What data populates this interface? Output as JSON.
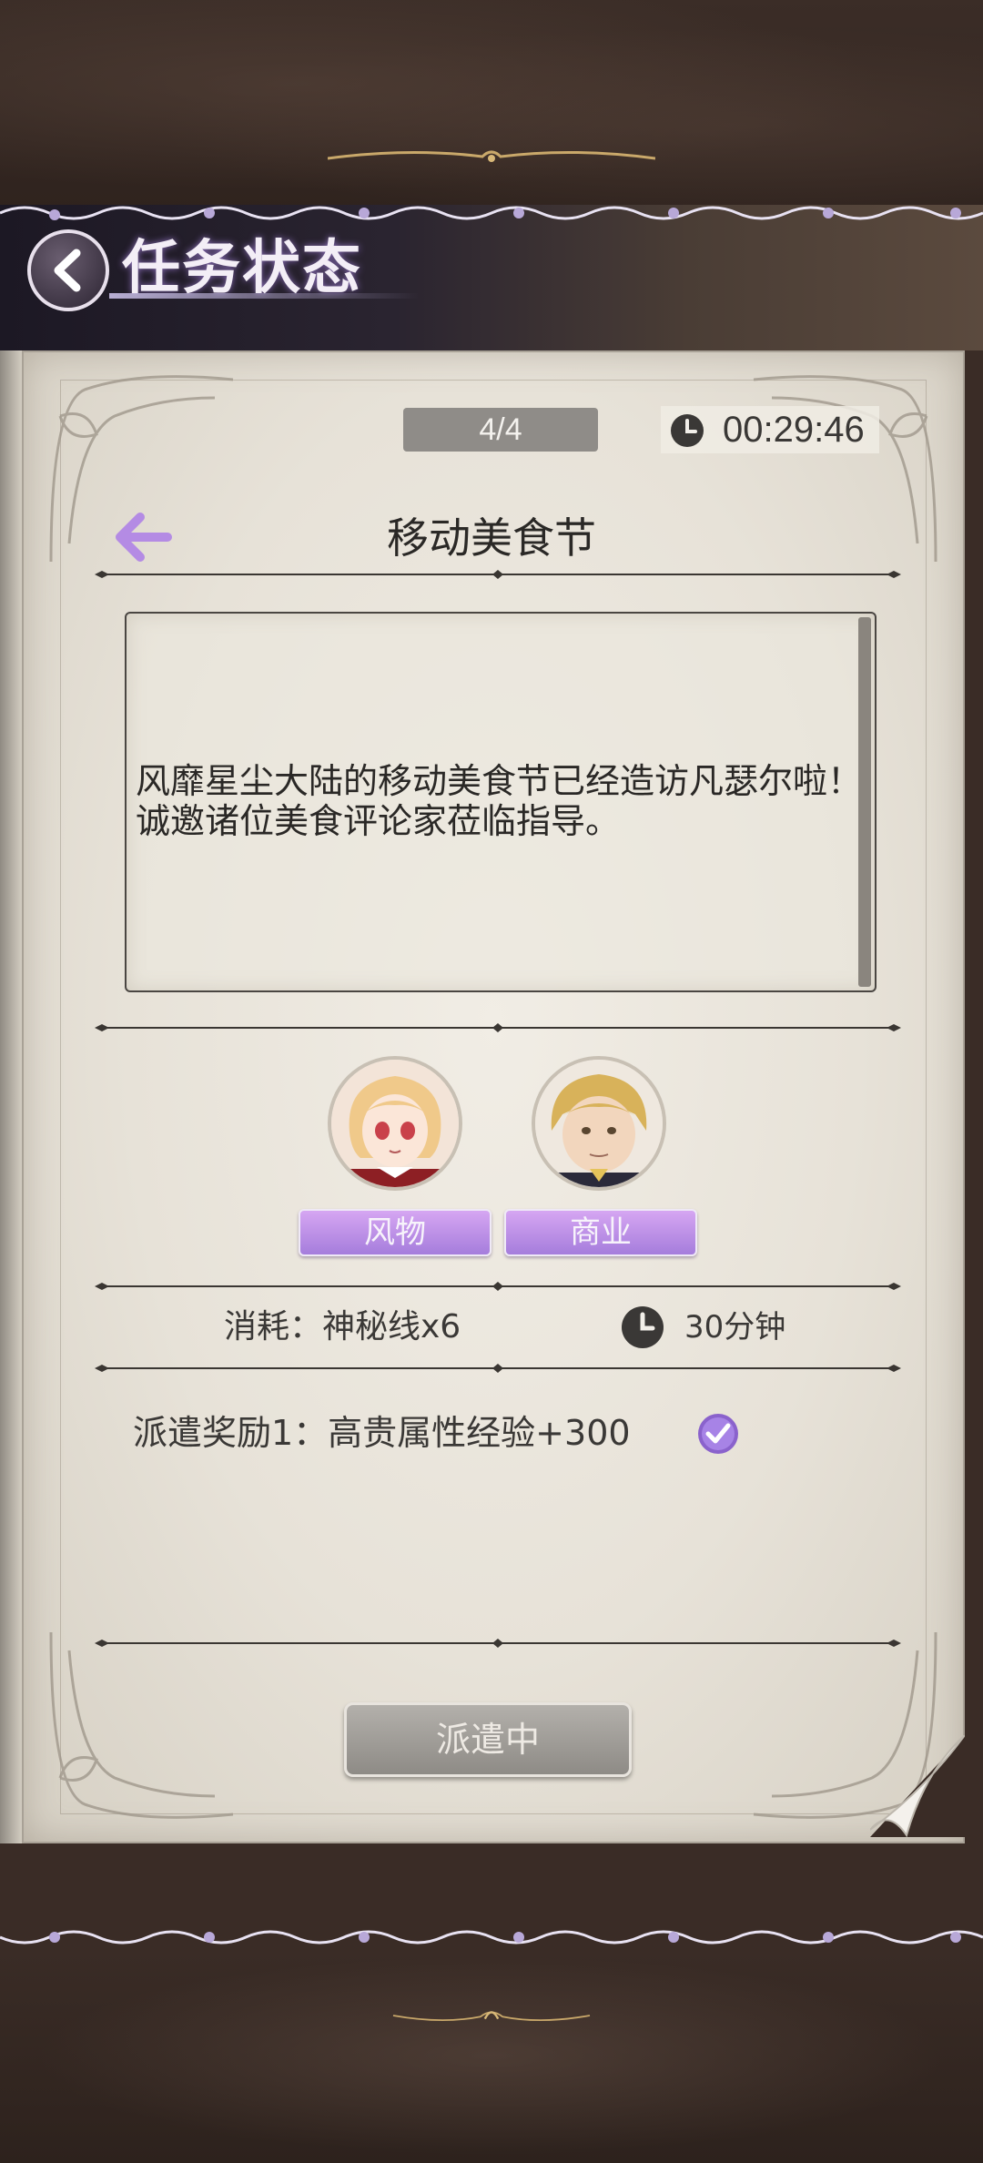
{
  "header": {
    "title": "任务状态"
  },
  "mission": {
    "progress": "4/4",
    "timer": "00:29:46",
    "title": "移动美食节",
    "description": "风靡星尘大陆的移动美食节已经造访凡瑟尔啦！诚邀诸位美食评论家莅临指导。",
    "tags": [
      "风物",
      "商业"
    ],
    "cost": "消耗：神秘线x6",
    "duration": "30分钟",
    "reward": "派遣奖励1：高贵属性经验+300",
    "reward_achieved": true,
    "button_label": "派遣中"
  },
  "colors": {
    "accent_purple": "#a57ddc",
    "page_bg": "#e7e2d8",
    "frame_dark": "#3a2c26"
  },
  "icons": {
    "back": "chevron-left-icon",
    "timer": "clock-icon",
    "mission_back": "arrow-left-icon",
    "reward_status": "checkmark-icon"
  }
}
